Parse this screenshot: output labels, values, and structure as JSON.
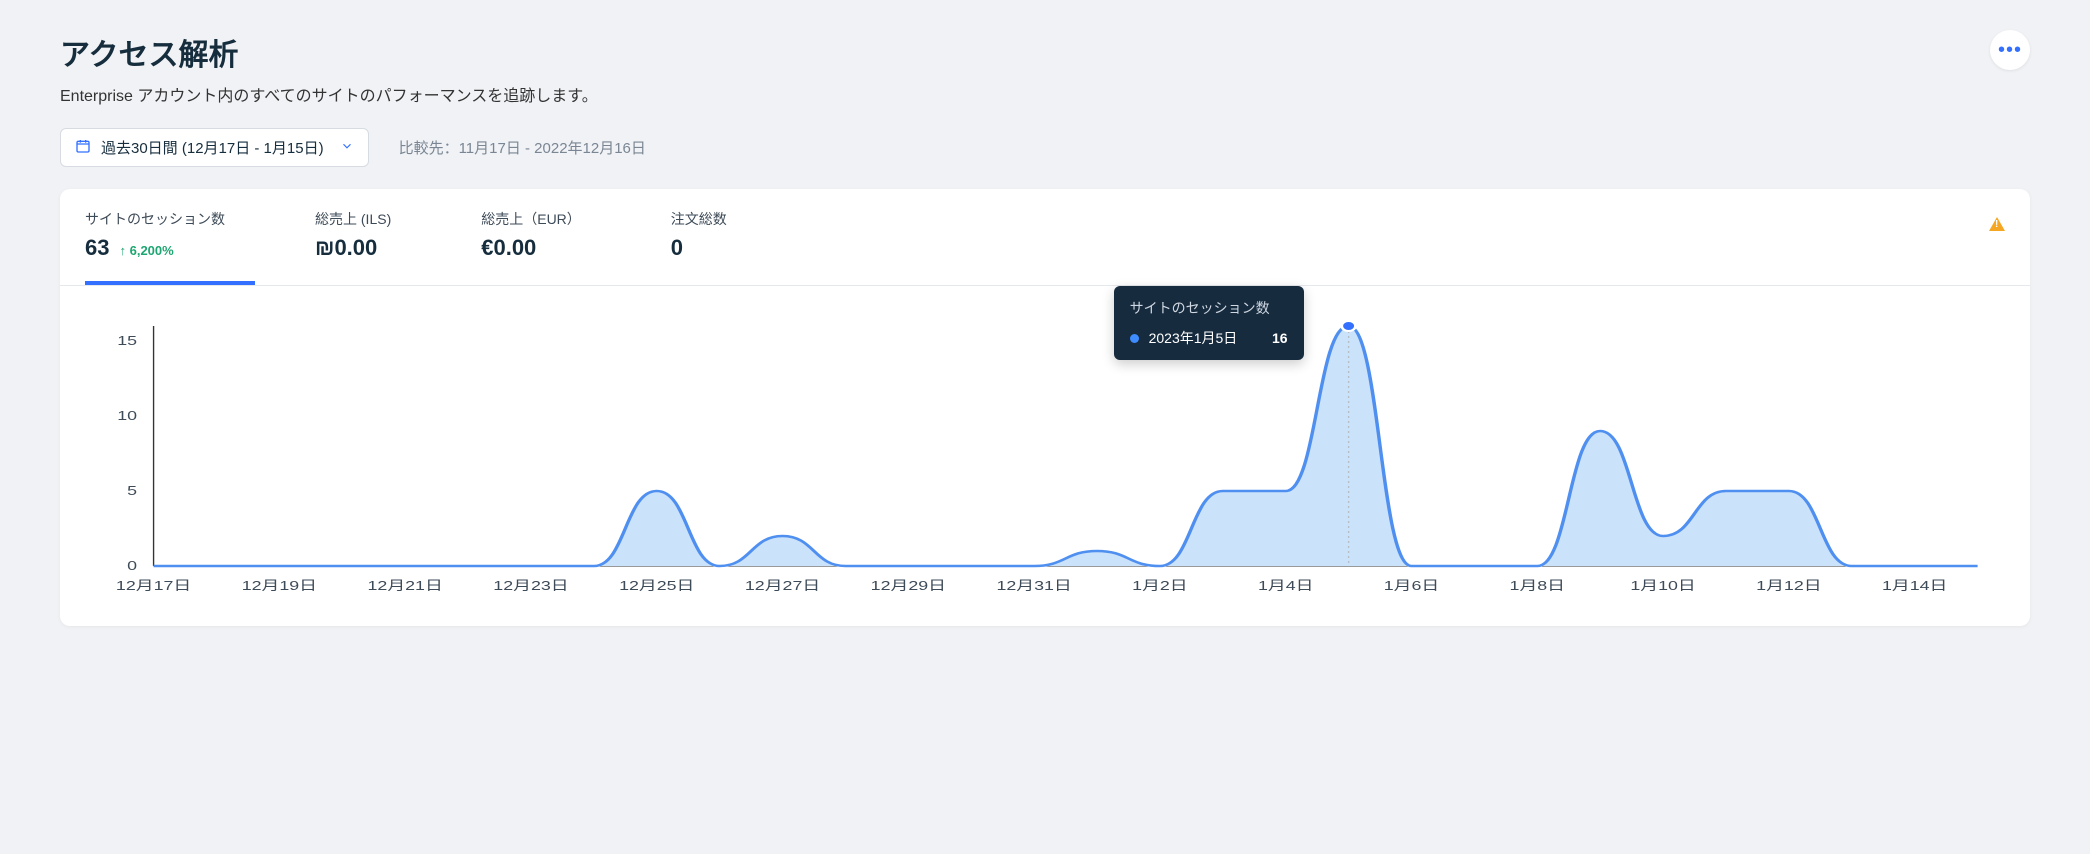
{
  "header": {
    "title": "アクセス解析",
    "subtitle": "Enterprise アカウント内のすべてのサイトのパフォーマンスを追跡します。"
  },
  "controls": {
    "date_range_label": "過去30日間 (12月17日 - 1月15日)",
    "compare_label": "比較先：11月17日 - 2022年12月16日"
  },
  "tabs": {
    "sessions": {
      "label": "サイトのセッション数",
      "value": "63",
      "delta": "6,200%"
    },
    "sales_ils": {
      "label": "総売上 (ILS)",
      "value": "₪0.00"
    },
    "sales_eur": {
      "label": "総売上（EUR）",
      "value": "€0.00"
    },
    "orders": {
      "label": "注文総数",
      "value": "0"
    }
  },
  "tooltip": {
    "title": "サイトのセッション数",
    "date": "2023年1月5日",
    "value": "16"
  },
  "chart_data": {
    "type": "area",
    "title": "サイトのセッション数",
    "xlabel": "",
    "ylabel": "",
    "ylim": [
      0,
      16
    ],
    "y_ticks": [
      0,
      5,
      10,
      15
    ],
    "x_tick_labels": [
      "12月17日",
      "12月19日",
      "12月21日",
      "12月23日",
      "12月25日",
      "12月27日",
      "12月29日",
      "12月31日",
      "1月2日",
      "1月4日",
      "1月6日",
      "1月8日",
      "1月10日",
      "1月12日",
      "1月14日"
    ],
    "categories": [
      "12月17日",
      "12月18日",
      "12月19日",
      "12月20日",
      "12月21日",
      "12月22日",
      "12月23日",
      "12月24日",
      "12月25日",
      "12月26日",
      "12月27日",
      "12月28日",
      "12月29日",
      "12月30日",
      "12月31日",
      "1月1日",
      "1月2日",
      "1月3日",
      "1月4日",
      "1月5日",
      "1月6日",
      "1月7日",
      "1月8日",
      "1月9日",
      "1月10日",
      "1月11日",
      "1月12日",
      "1月13日",
      "1月14日",
      "1月15日"
    ],
    "values": [
      0,
      0,
      0,
      0,
      0,
      0,
      0,
      0,
      5,
      0,
      2,
      0,
      0,
      0,
      0,
      1,
      0,
      5,
      5,
      16,
      0,
      0,
      0,
      9,
      2,
      5,
      5,
      0,
      0,
      0
    ],
    "highlight_index": 19
  }
}
